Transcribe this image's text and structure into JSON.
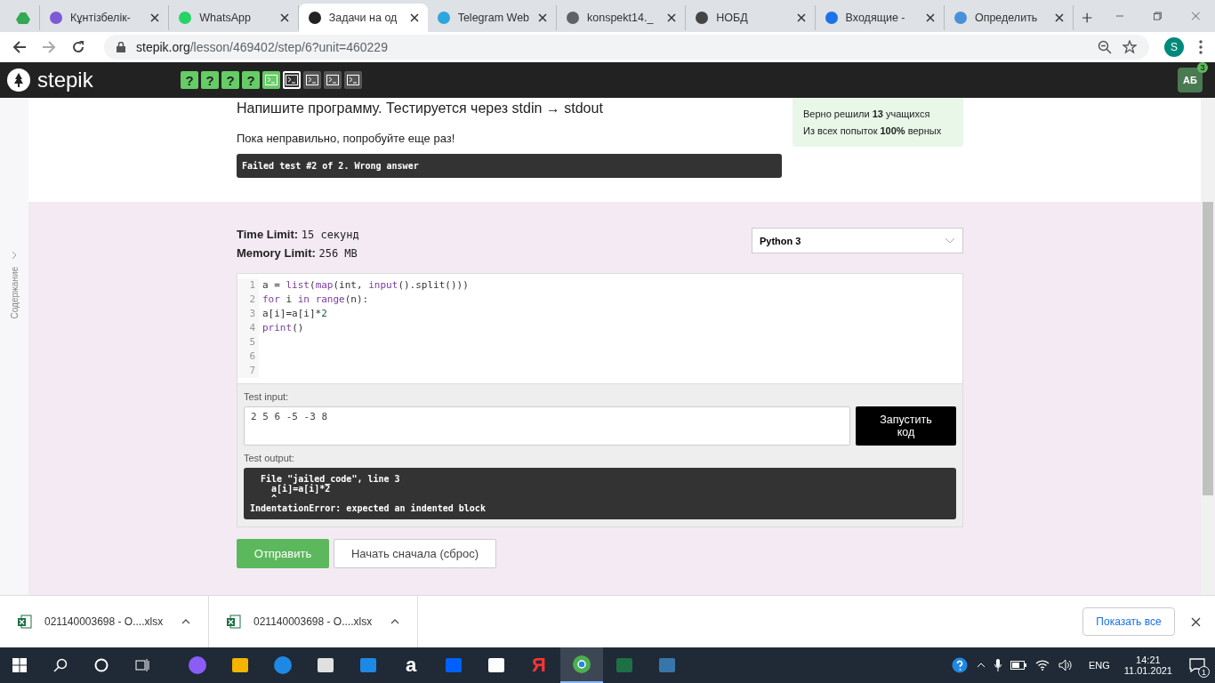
{
  "browser": {
    "tabs": [
      {
        "kind": "drive",
        "selected": false
      },
      {
        "kind": "hand",
        "title": "Кұнтізбелік-",
        "selected": false
      },
      {
        "kind": "whatsapp",
        "title": "WhatsApp",
        "selected": false
      },
      {
        "kind": "stepik",
        "title": "Задачи на од",
        "selected": true
      },
      {
        "kind": "telegram",
        "title": "Telegram Web",
        "selected": false
      },
      {
        "kind": "globe",
        "title": "konspekt14._",
        "selected": false
      },
      {
        "kind": "ball",
        "title": "НОБД",
        "selected": false
      },
      {
        "kind": "mail",
        "title": "Входящие -",
        "selected": false
      },
      {
        "kind": "dots",
        "title": "Определить",
        "selected": false
      }
    ],
    "url_host": "stepik.org",
    "url_path": "/lesson/469402/step/6?unit=460229",
    "profile": "S"
  },
  "header": {
    "logo": "stepik",
    "steps": [
      {
        "kind": "quiz",
        "label": "?",
        "passed": true,
        "selected": false
      },
      {
        "kind": "quiz",
        "label": "?",
        "passed": true,
        "selected": false
      },
      {
        "kind": "quiz",
        "label": "?",
        "passed": true,
        "selected": false
      },
      {
        "kind": "quiz",
        "label": "?",
        "passed": true,
        "selected": false
      },
      {
        "kind": "code",
        "passed": true,
        "selected": false
      },
      {
        "kind": "code",
        "passed": false,
        "selected": true
      },
      {
        "kind": "code",
        "passed": false,
        "selected": false
      },
      {
        "kind": "code",
        "passed": false,
        "selected": false
      },
      {
        "kind": "code",
        "passed": false,
        "selected": false
      }
    ],
    "avatar": "АБ",
    "avatar_badge": "3"
  },
  "sidebar_label": "Содержание",
  "task": {
    "heading": "Напишите программу. Тестируется через stdin → stdout",
    "feedback": "Пока неправильно, попробуйте еще раз!",
    "result": "Failed test #2 of 2. Wrong answer"
  },
  "stats": [
    "Верно решили **13** учащихся",
    "Из всех попыток **100%** верных"
  ],
  "limits": [
    {
      "label": "Time Limit:",
      "value": "15 секунд"
    },
    {
      "label": "Memory Limit:",
      "value": "256 MB"
    }
  ],
  "language": "Python 3",
  "code_lines": [
    {
      "number": "1",
      "tokens": [
        {
          "text": "a = ",
          "kind": "plain"
        },
        {
          "text": "list",
          "kind": "builtin"
        },
        {
          "text": "(",
          "kind": "plain"
        },
        {
          "text": "map",
          "kind": "builtin"
        },
        {
          "text": "(int, ",
          "kind": "plain"
        },
        {
          "text": "input",
          "kind": "builtin"
        },
        {
          "text": "().split()))",
          "kind": "plain"
        }
      ]
    },
    {
      "number": "2",
      "tokens": [
        {
          "text": "for",
          "kind": "keyword"
        },
        {
          "text": " i ",
          "kind": "plain"
        },
        {
          "text": "in ",
          "kind": "keyword"
        },
        {
          "text": "range",
          "kind": "builtin"
        },
        {
          "text": "(n):",
          "kind": "plain"
        }
      ]
    },
    {
      "number": "3",
      "tokens": [
        {
          "text": "a[i]=a[i]*",
          "kind": "plain"
        },
        {
          "text": "2",
          "kind": "number"
        }
      ]
    },
    {
      "number": "4",
      "tokens": [
        {
          "text": "print",
          "kind": "builtin"
        },
        {
          "text": "()",
          "kind": "plain"
        }
      ]
    },
    {
      "number": "5"
    },
    {
      "number": "6"
    },
    {
      "number": "7"
    }
  ],
  "test_input": {
    "label": "Test input:",
    "value": "2 5 6 -5 -3 8"
  },
  "run_button": "Запустить код",
  "test_output": {
    "label": "Test output:",
    "lines": [
      "  File \"jailed_code\", line 3",
      "    a[i]=a[i]*2",
      "    ^",
      "IndentationError: expected an indented block"
    ]
  },
  "buttons": {
    "submit": "Отправить",
    "reset": "Начать сначала (сброс)"
  },
  "downloads": {
    "items": [
      "021140003698 - O....xlsx",
      "021140003698 - O....xlsx"
    ],
    "show_all": "Показать все"
  },
  "taskbar": {
    "apps": [
      {
        "kind": "alice",
        "active": false
      },
      {
        "kind": "folder",
        "active": false
      },
      {
        "kind": "edge",
        "active": false
      },
      {
        "kind": "store",
        "active": false
      },
      {
        "kind": "mail",
        "active": false
      },
      {
        "kind": "amazon",
        "glyph": "a",
        "active": false
      },
      {
        "kind": "dropbox",
        "active": false
      },
      {
        "kind": "bolt",
        "active": false
      },
      {
        "kind": "yandex",
        "glyph": "Я",
        "active": false
      },
      {
        "kind": "chrome",
        "active": true
      },
      {
        "kind": "excel",
        "active": false
      },
      {
        "kind": "python",
        "active": false
      }
    ],
    "lang": "ENG",
    "time": "14:21",
    "date": "11.01.2021",
    "notifications": "1"
  }
}
